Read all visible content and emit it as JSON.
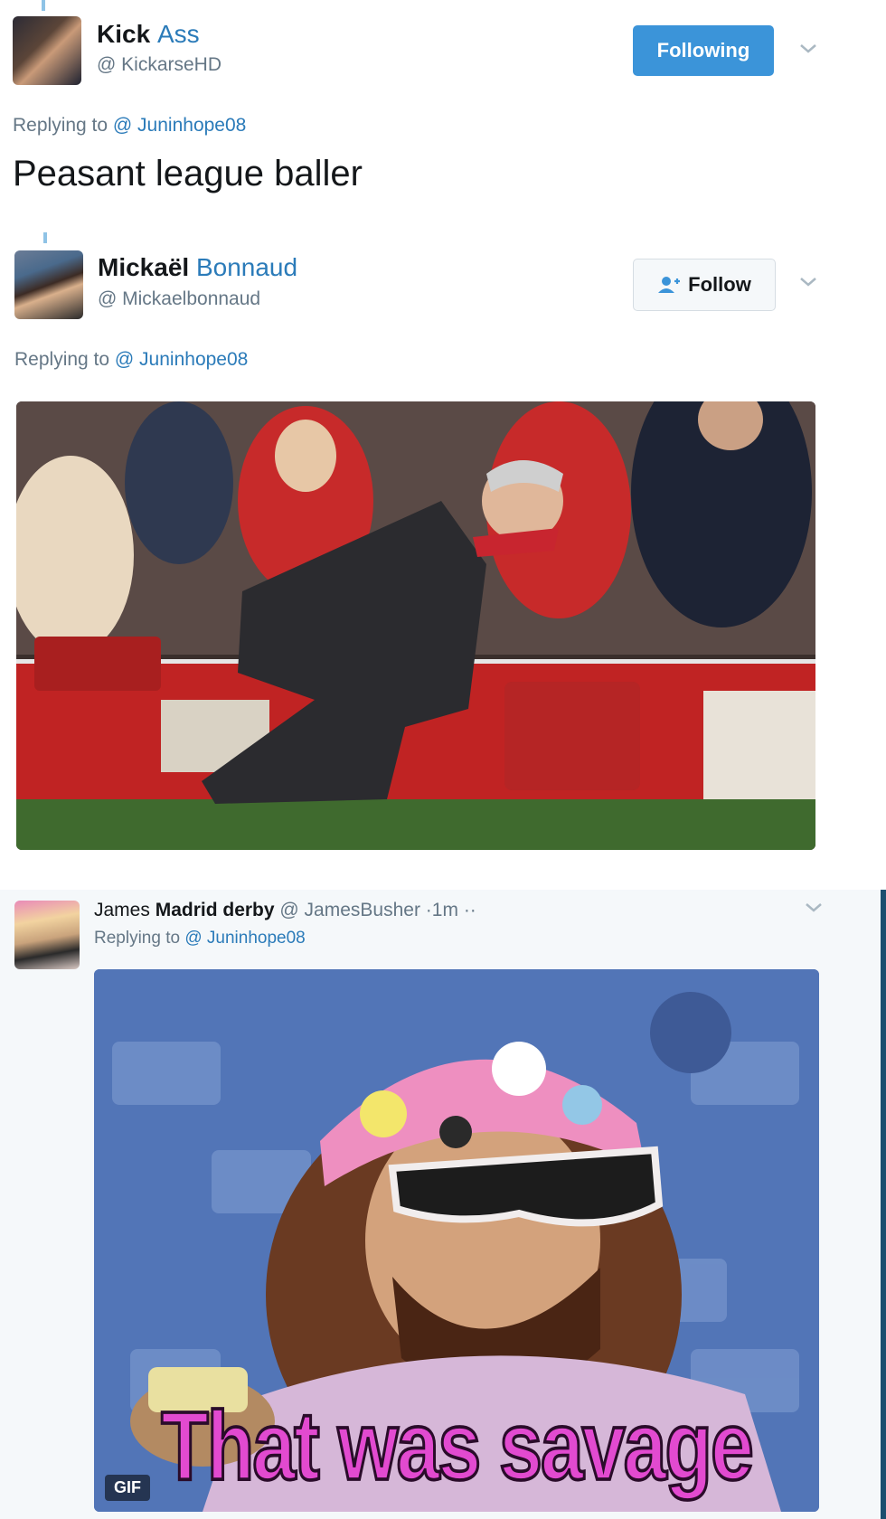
{
  "tweet1": {
    "name_first": "Kick",
    "name_second": "Ass",
    "handle": "@ KickarseHD",
    "follow_state": "Following",
    "replying_label": "Replying to",
    "replying_to": "@ Juninhope08",
    "text": "Peasant league baller"
  },
  "tweet2": {
    "name_first": "Mickaël",
    "name_second": "Bonnaud",
    "handle": "@ Mickaelbonnaud",
    "follow_label": "Follow",
    "replying_label": "Replying to",
    "replying_to": "@ Juninhope08"
  },
  "tweet3": {
    "name_first": "James",
    "name_second": "Madrid derby",
    "handle": "@ JamesBusher",
    "time": "·1m",
    "more": "··",
    "replying_label": "Replying to",
    "replying_to": "@ Juninhope08",
    "gif_label": "GIF",
    "gif_caption": "That was savage"
  },
  "colors": {
    "link_blue": "#2b7bb9",
    "following_button": "#3b94d9",
    "gif_caption": "#e24ad0"
  },
  "icons": [
    "chevron-down-icon",
    "add-person-icon"
  ]
}
